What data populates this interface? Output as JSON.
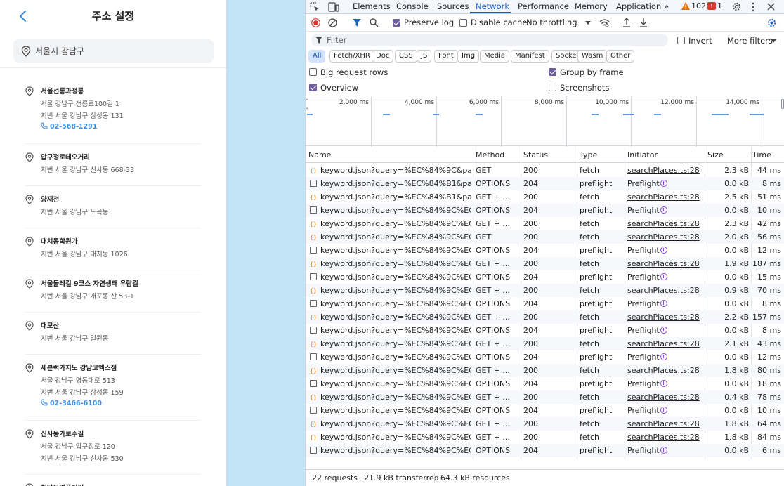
{
  "app": {
    "title": "주소 설정",
    "search_value": "서울시 강남구",
    "places": [
      {
        "name": "서울선릉과정릉",
        "lines": [
          "서울 강남구 선릉로100길 1",
          "지번 서울 강남구 삼성동 131"
        ],
        "phone": "02-568-1291"
      },
      {
        "name": "압구정로데오거리",
        "lines": [
          "지번 서울 강남구 신사동 668-33"
        ],
        "phone": ""
      },
      {
        "name": "양재천",
        "lines": [
          "지번 서울 강남구 도곡동"
        ],
        "phone": ""
      },
      {
        "name": "대치동학원가",
        "lines": [
          "지번 서울 강남구 대치동 1026"
        ],
        "phone": ""
      },
      {
        "name": "서울둘레길 9코스 자연생태 유람길",
        "lines": [
          "지번 서울 강남구 개포동 산 53-1"
        ],
        "phone": ""
      },
      {
        "name": "대모산",
        "lines": [
          "지번 서울 강남구 일원동"
        ],
        "phone": ""
      },
      {
        "name": "세븐럭카지노 강남코엑스점",
        "lines": [
          "서울 강남구 영동대로 513",
          "지번 서울 강남구 삼성동 159"
        ],
        "phone": "02-3466-6100"
      },
      {
        "name": "신사동가로수길",
        "lines": [
          "서울 강남구 압구정로 120",
          "지번 서울 강남구 신사동 530"
        ],
        "phone": ""
      },
      {
        "name": "청담동명품거리",
        "lines": [],
        "phone": ""
      }
    ]
  },
  "devtools": {
    "tabs": [
      "Elements",
      "Console",
      "Sources",
      "Network",
      "Performance",
      "Memory",
      "Application"
    ],
    "active_tab": "Network",
    "more_tabs": "»",
    "warnings": "102",
    "errors": "1",
    "toolbar": {
      "preserve_log": "Preserve log",
      "disable_cache": "Disable cache",
      "throttling": "No throttling"
    },
    "filter": {
      "placeholder": "Filter",
      "invert": "Invert",
      "more_filters": "More filters"
    },
    "type_filters": [
      "All",
      "Fetch/XHR",
      "Doc",
      "CSS",
      "JS",
      "Font",
      "Img",
      "Media",
      "Manifest",
      "Socket",
      "Wasm",
      "Other"
    ],
    "options": {
      "big_rows": "Big request rows",
      "group_by_frame": "Group by frame",
      "overview": "Overview",
      "screenshots": "Screenshots"
    },
    "overview_ticks": [
      "2,000 ms",
      "4,000 ms",
      "6,000 ms",
      "8,000 ms",
      "10,000 ms",
      "12,000 ms",
      "14,000 ms"
    ],
    "columns": [
      "Name",
      "Method",
      "Status",
      "Type",
      "Initiator",
      "Size",
      "Time"
    ],
    "requests": [
      {
        "icon": "xhr",
        "name": "keyword.json?query=%EC%84%9C&page...",
        "method": "GET",
        "status": "200",
        "type": "fetch",
        "initiator": "searchPlaces.ts:28",
        "size": "2.3 kB",
        "time": "44 ms"
      },
      {
        "icon": "doc",
        "name": "keyword.json?query=%EC%84%B1&page...",
        "method": "OPTIONS",
        "status": "204",
        "type": "preflight",
        "initiator": "Preflight",
        "size": "0.0 kB",
        "time": "8 ms"
      },
      {
        "icon": "xhr",
        "name": "keyword.json?query=%EC%84%B1&page...",
        "method": "GET + ...",
        "status": "200",
        "type": "fetch",
        "initiator": "searchPlaces.ts:28",
        "size": "2.5 kB",
        "time": "51 ms"
      },
      {
        "icon": "doc",
        "name": "keyword.json?query=%EC%84%9C%EC%9...",
        "method": "OPTIONS",
        "status": "204",
        "type": "preflight",
        "initiator": "Preflight",
        "size": "0.0 kB",
        "time": "10 ms"
      },
      {
        "icon": "xhr",
        "name": "keyword.json?query=%EC%84%9C%EC%9...",
        "method": "GET + ...",
        "status": "200",
        "type": "fetch",
        "initiator": "searchPlaces.ts:28",
        "size": "2.3 kB",
        "time": "42 ms"
      },
      {
        "icon": "xhr",
        "name": "keyword.json?query=%EC%84%9C%EC%9...",
        "method": "GET",
        "status": "200",
        "type": "fetch",
        "initiator": "searchPlaces.ts:28",
        "size": "2.0 kB",
        "time": "56 ms"
      },
      {
        "icon": "doc",
        "name": "keyword.json?query=%EC%84%9C%EC%9...",
        "method": "OPTIONS",
        "status": "204",
        "type": "preflight",
        "initiator": "Preflight",
        "size": "0.0 kB",
        "time": "12 ms"
      },
      {
        "icon": "xhr",
        "name": "keyword.json?query=%EC%84%9C%EC%9...",
        "method": "GET + ...",
        "status": "200",
        "type": "fetch",
        "initiator": "searchPlaces.ts:28",
        "size": "1.9 kB",
        "time": "187 ms"
      },
      {
        "icon": "doc",
        "name": "keyword.json?query=%EC%84%9C%EC%9...",
        "method": "OPTIONS",
        "status": "204",
        "type": "preflight",
        "initiator": "Preflight",
        "size": "0.0 kB",
        "time": "15 ms"
      },
      {
        "icon": "xhr",
        "name": "keyword.json?query=%EC%84%9C%EC%9...",
        "method": "GET + ...",
        "status": "200",
        "type": "fetch",
        "initiator": "searchPlaces.ts:28",
        "size": "0.9 kB",
        "time": "70 ms"
      },
      {
        "icon": "doc",
        "name": "keyword.json?query=%EC%84%9C%EC%9...",
        "method": "OPTIONS",
        "status": "204",
        "type": "preflight",
        "initiator": "Preflight",
        "size": "0.0 kB",
        "time": "8 ms"
      },
      {
        "icon": "xhr",
        "name": "keyword.json?query=%EC%84%9C%EC%9...",
        "method": "GET + ...",
        "status": "200",
        "type": "fetch",
        "initiator": "searchPlaces.ts:28",
        "size": "2.2 kB",
        "time": "157 ms"
      },
      {
        "icon": "doc",
        "name": "keyword.json?query=%EC%84%9C%EC%9...",
        "method": "OPTIONS",
        "status": "204",
        "type": "preflight",
        "initiator": "Preflight",
        "size": "0.0 kB",
        "time": "8 ms"
      },
      {
        "icon": "xhr",
        "name": "keyword.json?query=%EC%84%9C%EC%9...",
        "method": "GET + ...",
        "status": "200",
        "type": "fetch",
        "initiator": "searchPlaces.ts:28",
        "size": "2.1 kB",
        "time": "43 ms"
      },
      {
        "icon": "doc",
        "name": "keyword.json?query=%EC%84%9C%EC%9...",
        "method": "OPTIONS",
        "status": "204",
        "type": "preflight",
        "initiator": "Preflight",
        "size": "0.0 kB",
        "time": "12 ms"
      },
      {
        "icon": "xhr",
        "name": "keyword.json?query=%EC%84%9C%EC%9...",
        "method": "GET + ...",
        "status": "200",
        "type": "fetch",
        "initiator": "searchPlaces.ts:28",
        "size": "1.8 kB",
        "time": "80 ms"
      },
      {
        "icon": "doc",
        "name": "keyword.json?query=%EC%84%9C%EC%9...",
        "method": "OPTIONS",
        "status": "204",
        "type": "preflight",
        "initiator": "Preflight",
        "size": "0.0 kB",
        "time": "18 ms"
      },
      {
        "icon": "xhr",
        "name": "keyword.json?query=%EC%84%9C%EC%9...",
        "method": "GET + ...",
        "status": "200",
        "type": "fetch",
        "initiator": "searchPlaces.ts:28",
        "size": "0.4 kB",
        "time": "78 ms"
      },
      {
        "icon": "doc",
        "name": "keyword.json?query=%EC%84%9C%EC%9...",
        "method": "OPTIONS",
        "status": "204",
        "type": "preflight",
        "initiator": "Preflight",
        "size": "0.0 kB",
        "time": "10 ms"
      },
      {
        "icon": "xhr",
        "name": "keyword.json?query=%EC%84%9C%EC%9...",
        "method": "GET + ...",
        "status": "200",
        "type": "fetch",
        "initiator": "searchPlaces.ts:28",
        "size": "1.8 kB",
        "time": "64 ms"
      },
      {
        "icon": "xhr",
        "name": "keyword.json?query=%EC%84%9C%EC%9...",
        "method": "GET + ...",
        "status": "200",
        "type": "fetch",
        "initiator": "searchPlaces.ts:28",
        "size": "1.8 kB",
        "time": "84 ms"
      },
      {
        "icon": "doc",
        "name": "keyword.json?query=%EC%84%9C%EC%9...",
        "method": "OPTIONS",
        "status": "204",
        "type": "preflight",
        "initiator": "Preflight",
        "size": "0.0 kB",
        "time": "6 ms"
      }
    ],
    "status_bar": {
      "requests": "22 requests",
      "transferred": "21.9 kB transferred",
      "resources": "64.3 kB resources"
    }
  },
  "colors": {
    "accent": "#1a5fc4",
    "phone_link": "#3c8de0",
    "checkbox_checked": "#6e5f9c",
    "side_gap": "#c3e3f7"
  }
}
